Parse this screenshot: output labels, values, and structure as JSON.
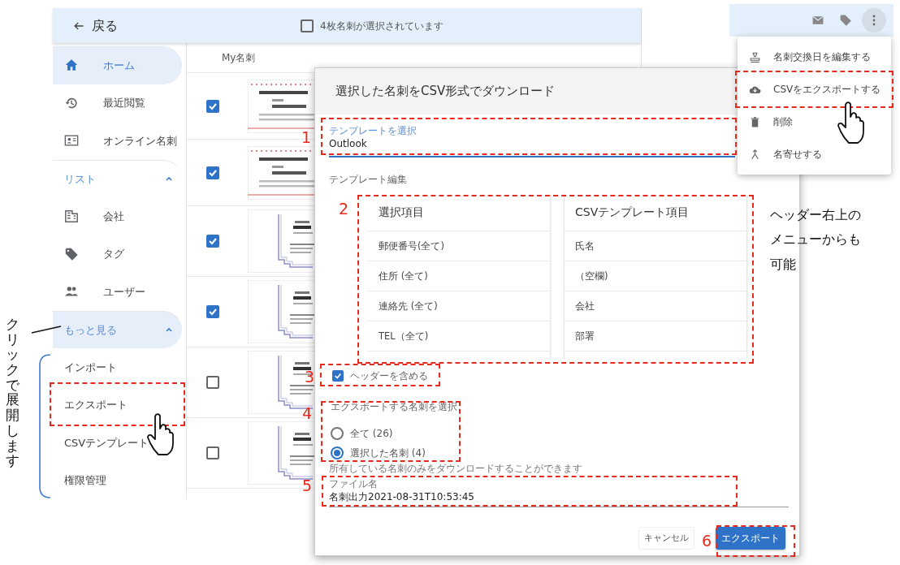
{
  "header": {
    "back_label": "戻る",
    "selection_label": "4枚名刺が選択されています",
    "select_all_checked": false
  },
  "sidebar": {
    "items": [
      {
        "kind": "link",
        "label": "ホーム",
        "selected": true
      },
      {
        "kind": "link",
        "label": "最近閲覧",
        "selected": false
      },
      {
        "kind": "link",
        "label": "オンライン名刺",
        "selected": false
      },
      {
        "kind": "group",
        "label": "リスト",
        "expanded": true,
        "highlighted": false,
        "children": [
          {
            "kind": "link",
            "label": "会社",
            "selected": false
          },
          {
            "kind": "link",
            "label": "タグ",
            "selected": false
          },
          {
            "kind": "link",
            "label": "ユーザー",
            "selected": false
          }
        ]
      },
      {
        "kind": "group",
        "label": "もっと見る",
        "expanded": true,
        "highlighted": true,
        "children": [
          {
            "kind": "link",
            "label": "インポート",
            "selected": false
          },
          {
            "kind": "link",
            "label": "エクスポート",
            "selected": false
          },
          {
            "kind": "link",
            "label": "CSVテンプレート",
            "selected": false
          },
          {
            "kind": "link",
            "label": "権限管理",
            "selected": false
          }
        ]
      }
    ]
  },
  "table": {
    "columns": [
      "My名刺"
    ],
    "rows": [
      {
        "checked": true,
        "kind": "horizontal"
      },
      {
        "checked": true,
        "kind": "horizontal"
      },
      {
        "checked": true,
        "kind": "vertical"
      },
      {
        "checked": true,
        "kind": "vertical"
      },
      {
        "checked": false,
        "kind": "vertical"
      },
      {
        "checked": false,
        "kind": "vertical"
      }
    ]
  },
  "dialog": {
    "title": "選択した名刺をCSV形式でダウンロード",
    "template_field": {
      "label": "テンプレートを選択",
      "value": "Outlook"
    },
    "section_label": "テンプレート編集",
    "mapping": {
      "columns": [
        "選択項目",
        "CSVテンプレート項目"
      ],
      "left": [
        "郵便番号(全て)",
        "住所 (全て)",
        "連絡先 (全て)",
        "TEL（全て)"
      ],
      "right": [
        "氏名",
        "（空欄)",
        "会社",
        "部署"
      ]
    },
    "include_header": {
      "label": "ヘッダーを含める",
      "checked": true
    },
    "export_scope": {
      "label": "エクスポートする名刺を選択",
      "options": [
        {
          "label": "全て (26)",
          "selected": false
        },
        {
          "label": "選択した名刺 (4)",
          "selected": true
        }
      ],
      "hint": "所有している名刺のみをダウンロードすることができます"
    },
    "filename_field": {
      "label": "ファイル名",
      "value": "名刺出力2021-08-31T10:53:45"
    },
    "buttons": [
      {
        "label": "キャンセル",
        "kind": "text"
      },
      {
        "label": "エクスポート",
        "kind": "primary"
      }
    ]
  },
  "menu": {
    "items": [
      "名刺交換日を編集する",
      "CSVをエクスポートする",
      "削除",
      "名寄せする"
    ]
  },
  "annotations": {
    "numbers": [
      "1",
      "2",
      "3",
      "4",
      "5",
      "6"
    ],
    "left_note": "クリックで展開します",
    "right_note": "ヘッダー右上のメニューからも可能"
  }
}
